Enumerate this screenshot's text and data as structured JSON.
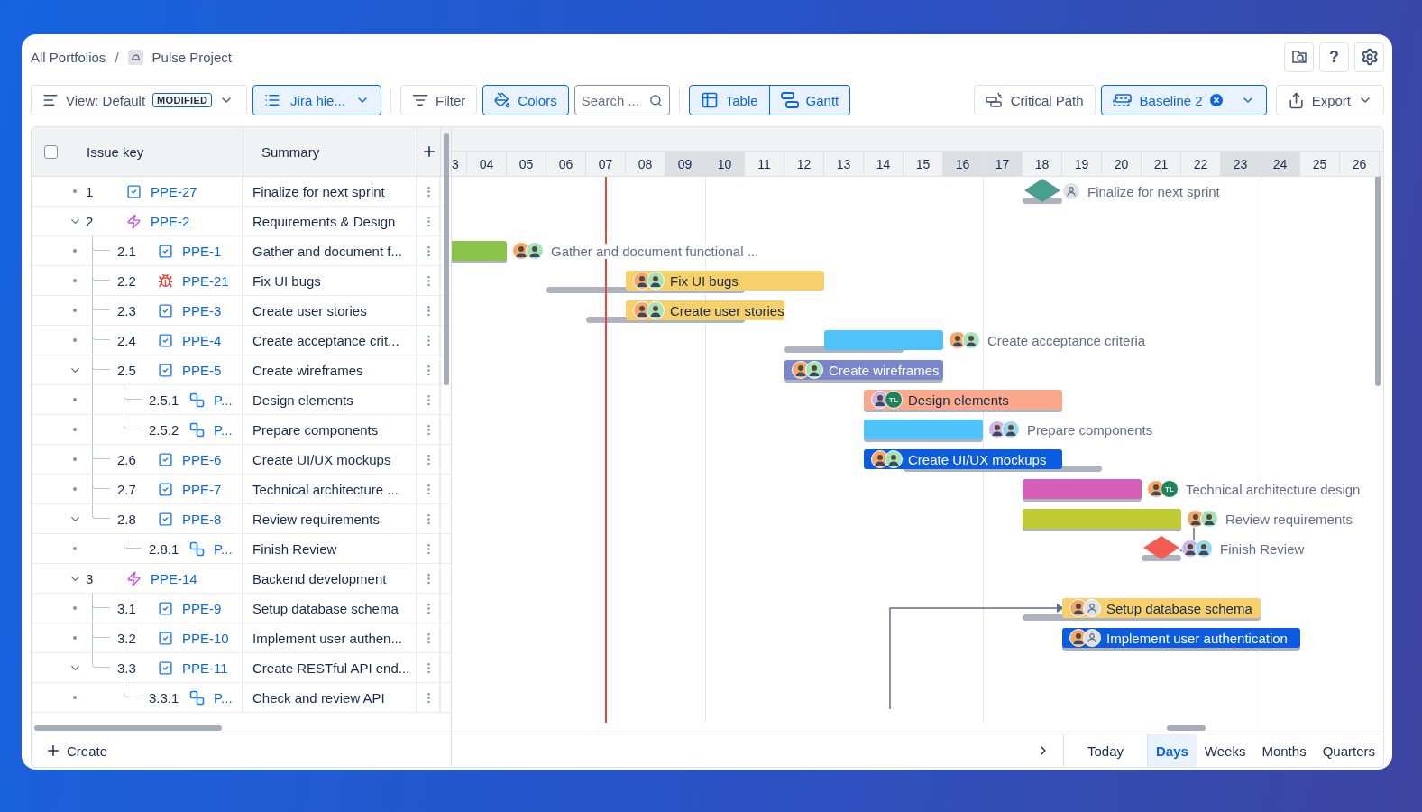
{
  "breadcrumb": {
    "items": [
      {
        "label": "All Portfolios"
      },
      {
        "label": "Pulse Project"
      }
    ],
    "separator": "/"
  },
  "header_actions": {
    "help": "?"
  },
  "toolbar": {
    "view": {
      "label": "View: Default",
      "badge": "MODIFIED"
    },
    "hierarchy": {
      "label": "Jira hie...",
      "selected": true
    },
    "filter": {
      "label": "Filter",
      "selected": false
    },
    "colors": {
      "label": "Colors",
      "selected": true
    },
    "search": {
      "placeholder": "Search ..."
    },
    "modes": [
      {
        "label": "Table",
        "kind": "table",
        "selected": true
      },
      {
        "label": "Gantt",
        "kind": "gantt",
        "selected": true
      }
    ],
    "critical_path": {
      "label": "Critical Path",
      "selected": false
    },
    "baseline": {
      "label": "Baseline 2",
      "selected": true
    },
    "export": {
      "label": "Export"
    }
  },
  "table": {
    "select_all": {
      "checked": false
    },
    "columns": [
      "Issue key",
      "Summary"
    ],
    "rows": [
      {
        "number": "1",
        "key": "PPE-27",
        "kind": "task",
        "summary": "Finalize for next sprint",
        "gantt": {
          "kind": "milestone",
          "color": "#4a9e8e",
          "label": "Finalize for next sprint",
          "avatars": [
            {
              "kind": "placeholder"
            }
          ]
        }
      },
      {
        "number": "2",
        "key": "PPE-2",
        "kind": "epic",
        "summary": "Requirements & Design",
        "expanded": true,
        "children": [
          {
            "number": "2.1",
            "key": "PPE-1",
            "kind": "task",
            "summary": "Gather and document f...",
            "gantt": {
              "kind": "bar",
              "color": "#8bc34a",
              "label": "Gather and document functional ...",
              "label_inside": false,
              "avatars": [
                {
                  "kind": "person"
                },
                {
                  "kind": "person"
                }
              ]
            }
          },
          {
            "number": "2.2",
            "key": "PPE-21",
            "kind": "bug",
            "summary": "Fix UI bugs",
            "gantt": {
              "kind": "bar",
              "color": "#f7d06b",
              "label": "Fix UI bugs",
              "label_inside": true,
              "avatars": [
                {
                  "kind": "person"
                },
                {
                  "kind": "person"
                }
              ]
            }
          },
          {
            "number": "2.3",
            "key": "PPE-3",
            "kind": "task",
            "summary": "Create user stories",
            "gantt": {
              "kind": "bar",
              "color": "#f7d06b",
              "label": "Create user stories",
              "label_inside": true,
              "avatars": [
                {
                  "kind": "person"
                },
                {
                  "kind": "person"
                }
              ]
            }
          },
          {
            "number": "2.4",
            "key": "PPE-4",
            "kind": "task",
            "summary": "Create acceptance crit...",
            "gantt": {
              "kind": "bar",
              "color": "#4fc3f7",
              "label": "Create acceptance criteria",
              "label_inside": false,
              "avatars": [
                {
                  "kind": "person"
                },
                {
                  "kind": "person"
                }
              ]
            }
          },
          {
            "number": "2.5",
            "key": "PPE-5",
            "kind": "task",
            "summary": "Create wireframes",
            "expanded": true,
            "gantt": {
              "kind": "bar",
              "color": "#7986cb",
              "label": "Create wireframes",
              "label_inside": true,
              "avatars": [
                {
                  "kind": "person"
                },
                {
                  "kind": "person"
                }
              ]
            },
            "children": [
              {
                "number": "2.5.1",
                "key": "P...",
                "kind": "subtask",
                "summary": "Design elements",
                "gantt": {
                  "kind": "bar",
                  "color": "#fca98b",
                  "label": "Design elements",
                  "label_inside": true,
                  "avatars": [
                    {
                      "kind": "person"
                    },
                    {
                      "kind": "initials",
                      "initials": "TL"
                    }
                  ]
                }
              },
              {
                "number": "2.5.2",
                "key": "P...",
                "kind": "subtask",
                "summary": "Prepare components",
                "gantt": {
                  "kind": "bar",
                  "color": "#4fc3f7",
                  "label": "Prepare components",
                  "label_inside": false,
                  "avatars": [
                    {
                      "kind": "person"
                    },
                    {
                      "kind": "person"
                    }
                  ]
                }
              }
            ]
          },
          {
            "number": "2.6",
            "key": "PPE-6",
            "kind": "task",
            "summary": "Create UI/UX mockups",
            "gantt": {
              "kind": "bar",
              "color": "#0c5ce0",
              "label": "Create UI/UX mockups",
              "label_inside": true,
              "avatars": [
                {
                  "kind": "person"
                },
                {
                  "kind": "person"
                }
              ]
            }
          },
          {
            "number": "2.7",
            "key": "PPE-7",
            "kind": "task",
            "summary": "Technical architecture ...",
            "gantt": {
              "kind": "bar",
              "color": "#d65db8",
              "label": "Technical architecture design",
              "label_inside": false,
              "avatars": [
                {
                  "kind": "person"
                },
                {
                  "kind": "initials",
                  "initials": "TL"
                }
              ]
            }
          },
          {
            "number": "2.8",
            "key": "PPE-8",
            "kind": "task",
            "summary": "Review requirements",
            "expanded": true,
            "gantt": {
              "kind": "bar",
              "color": "#c0ca33",
              "label": "Review requirements",
              "label_inside": false,
              "avatars": [
                {
                  "kind": "person"
                },
                {
                  "kind": "person"
                }
              ]
            },
            "children": [
              {
                "number": "2.8.1",
                "key": "P...",
                "kind": "subtask",
                "summary": "Finish Review",
                "gantt": {
                  "kind": "milestone",
                  "color": "#f25c54",
                  "label": "Finish Review",
                  "avatars": [
                    {
                      "kind": "person"
                    },
                    {
                      "kind": "person"
                    }
                  ]
                }
              }
            ]
          }
        ]
      },
      {
        "number": "3",
        "key": "PPE-14",
        "kind": "epic",
        "summary": "Backend development",
        "expanded": true,
        "children": [
          {
            "number": "3.1",
            "key": "PPE-9",
            "kind": "task",
            "summary": "Setup database schema",
            "gantt": {
              "kind": "bar",
              "color": "#f7d06b",
              "label": "Setup database schema",
              "label_inside": true,
              "avatars": [
                {
                  "kind": "person"
                },
                {
                  "kind": "placeholder"
                }
              ]
            }
          },
          {
            "number": "3.2",
            "key": "PPE-10",
            "kind": "task",
            "summary": "Implement user authen...",
            "gantt": {
              "kind": "bar",
              "color": "#0c5ce0",
              "label": "Implement user authentication",
              "label_inside": true,
              "avatars": [
                {
                  "kind": "person"
                },
                {
                  "kind": "placeholder"
                }
              ]
            }
          },
          {
            "number": "3.3",
            "key": "PPE-11",
            "kind": "task",
            "summary": "Create RESTful API end...",
            "expanded": true,
            "children": [
              {
                "number": "3.3.1",
                "key": "P...",
                "kind": "subtask",
                "summary": "Check and review API"
              }
            ]
          }
        ]
      }
    ]
  },
  "timeline": {
    "days": [
      {
        "label": "3",
        "weekend": false
      },
      {
        "label": "04",
        "weekend": false
      },
      {
        "label": "05",
        "weekend": false
      },
      {
        "label": "06",
        "weekend": false
      },
      {
        "label": "07",
        "weekend": false
      },
      {
        "label": "08",
        "weekend": false
      },
      {
        "label": "09",
        "weekend": true
      },
      {
        "label": "10",
        "weekend": true
      },
      {
        "label": "11",
        "weekend": false
      },
      {
        "label": "12",
        "weekend": false
      },
      {
        "label": "13",
        "weekend": false
      },
      {
        "label": "14",
        "weekend": false
      },
      {
        "label": "15",
        "weekend": false
      },
      {
        "label": "16",
        "weekend": true
      },
      {
        "label": "17",
        "weekend": true
      },
      {
        "label": "18",
        "weekend": false
      },
      {
        "label": "19",
        "weekend": false
      },
      {
        "label": "20",
        "weekend": false
      },
      {
        "label": "21",
        "weekend": false
      },
      {
        "label": "22",
        "weekend": false
      },
      {
        "label": "23",
        "weekend": true
      },
      {
        "label": "24",
        "weekend": true
      },
      {
        "label": "25",
        "weekend": false
      },
      {
        "label": "26",
        "weekend": false
      }
    ]
  },
  "footer": {
    "create": "Create",
    "today": "Today",
    "scales": [
      {
        "label": "Days",
        "selected": true
      },
      {
        "label": "Weeks",
        "selected": false
      },
      {
        "label": "Months",
        "selected": false
      },
      {
        "label": "Quarters",
        "selected": false
      }
    ]
  }
}
